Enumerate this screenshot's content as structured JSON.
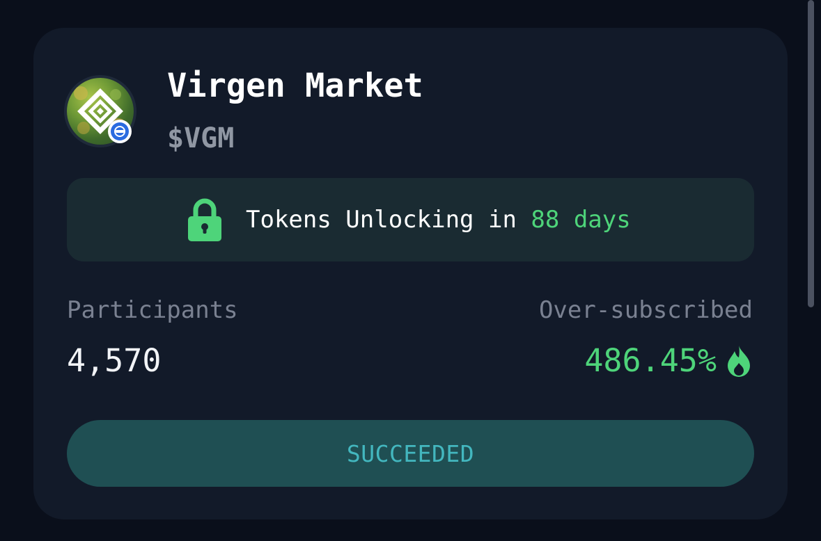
{
  "project": {
    "name": "Virgen Market",
    "ticker": "$VGM",
    "avatar_icon": "project-logo-diamond",
    "badge_icon": "verified-minus-badge-icon"
  },
  "unlock_banner": {
    "prefix": "Tokens Unlocking in",
    "days": "88 days",
    "icon": "lock-icon"
  },
  "stats": {
    "participants_label": "Participants",
    "participants_value": "4,570",
    "oversubscribed_label": "Over-subscribed",
    "oversubscribed_value": "486.45%",
    "oversubscribed_icon": "flame-icon"
  },
  "status_button": {
    "label": "SUCCEEDED"
  },
  "colors": {
    "background": "#0a0f1b",
    "card": "#121a29",
    "banner": "#1a2b32",
    "accent_green": "#4ed47a",
    "status_button_bg": "#1f4f53",
    "status_button_text": "#43b7bf",
    "muted_text": "#7a8191"
  }
}
